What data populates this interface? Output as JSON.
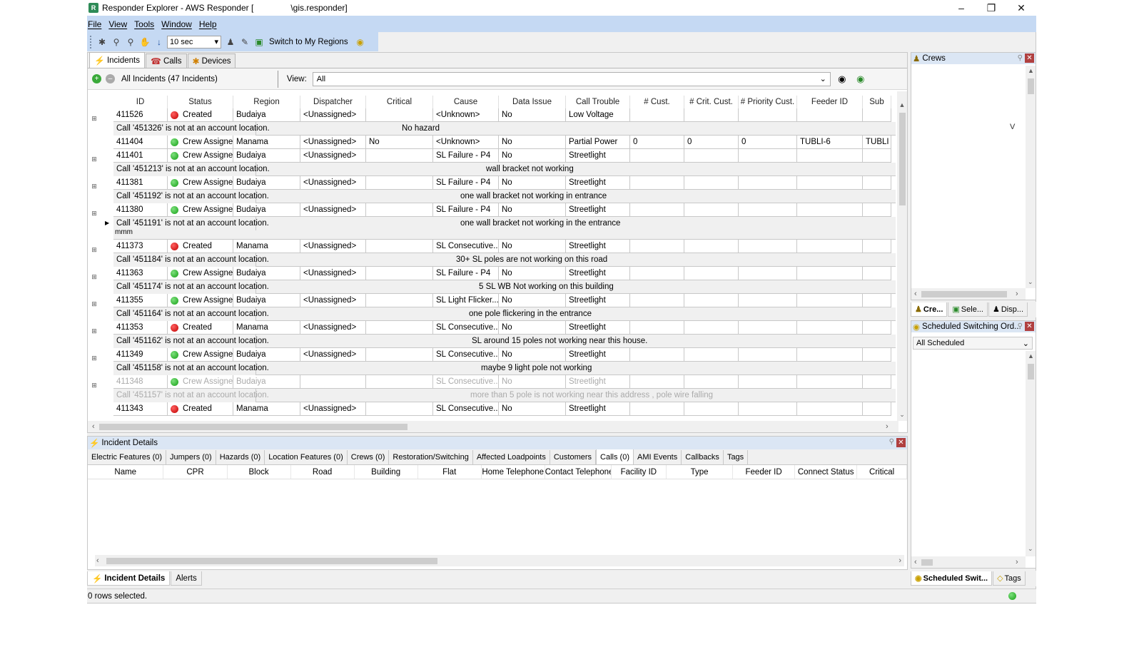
{
  "window": {
    "title": "Responder Explorer - AWS Responder [",
    "title_suffix": "\\gis.responder]"
  },
  "menu": [
    "File",
    "View",
    "Tools",
    "Window",
    "Help"
  ],
  "toolbar": {
    "interval": "10 sec",
    "switch_label": "Switch to My Regions"
  },
  "tabs": {
    "incidents": "Incidents",
    "calls": "Calls",
    "devices": "Devices"
  },
  "filter": {
    "all_label": "All Incidents (47 Incidents)",
    "view_label": "View:",
    "view_value": "All"
  },
  "columns": [
    "ID",
    "Status",
    "Region",
    "Dispatcher",
    "Critical",
    "Cause",
    "Data Issue",
    "Call Trouble",
    "# Cust.",
    "# Crit. Cust.",
    "# Priority Cust.",
    "Feeder ID",
    "Sub"
  ],
  "rows": [
    {
      "id": "411526",
      "status": "Created",
      "status_color": "#c00000",
      "region": "Budaiya",
      "dispatcher": "<Unassigned>",
      "critical": "",
      "cause": "<Unknown>",
      "data_issue": "No",
      "call_trouble": "Low Voltage",
      "cust": "",
      "crit": "",
      "prio": "",
      "feeder": "",
      "sub": "",
      "call": "Call '451326' is not at an account location.",
      "call_note": "No hazard"
    },
    {
      "id": "411404",
      "status": "Crew Assigned",
      "status_color": "#14a014",
      "region": "Manama",
      "dispatcher": "<Unassigned>",
      "critical": "No",
      "cause": "<Unknown>",
      "data_issue": "No",
      "call_trouble": "Partial Power",
      "cust": "0",
      "crit": "0",
      "prio": "0",
      "feeder": "TUBLI-6",
      "sub": "TUBLI",
      "call": "",
      "call_note": ""
    },
    {
      "id": "411401",
      "status": "Crew Assigned",
      "status_color": "#14a014",
      "region": "Budaiya",
      "dispatcher": "<Unassigned>",
      "critical": "",
      "cause": "SL Failure - P4",
      "data_issue": "No",
      "call_trouble": "Streetlight",
      "cust": "",
      "crit": "",
      "prio": "",
      "feeder": "",
      "sub": "",
      "call": "Call '451213' is not at an account location.",
      "call_note": "wall bracket not working"
    },
    {
      "id": "411381",
      "status": "Crew Assigned",
      "status_color": "#14a014",
      "region": "Budaiya",
      "dispatcher": "<Unassigned>",
      "critical": "",
      "cause": "SL Failure - P4",
      "data_issue": "No",
      "call_trouble": "Streetlight",
      "cust": "",
      "crit": "",
      "prio": "",
      "feeder": "",
      "sub": "",
      "call": "Call '451192' is not at an account location.",
      "call_note": "one wall bracket not working in entrance"
    },
    {
      "id": "411380",
      "status": "Crew Assigned",
      "status_color": "#14a014",
      "region": "Budaiya",
      "dispatcher": "<Unassigned>",
      "critical": "",
      "cause": "SL Failure - P4",
      "data_issue": "No",
      "call_trouble": "Streetlight",
      "cust": "",
      "crit": "",
      "prio": "",
      "feeder": "",
      "sub": "",
      "call": "Call '451191' is not at an account location.",
      "call_note": "one wall bracket not working in the entrance",
      "call_extra": "mmm"
    },
    {
      "id": "411373",
      "status": "Created",
      "status_color": "#c00000",
      "region": "Manama",
      "dispatcher": "<Unassigned>",
      "critical": "",
      "cause": "SL Consecutive...",
      "data_issue": "No",
      "call_trouble": "Streetlight",
      "cust": "",
      "crit": "",
      "prio": "",
      "feeder": "",
      "sub": "",
      "call": "Call '451184' is not at an account location.",
      "call_note": "30+ SL poles are not working on this road"
    },
    {
      "id": "411363",
      "status": "Crew Assigned",
      "status_color": "#14a014",
      "region": "Budaiya",
      "dispatcher": "<Unassigned>",
      "critical": "",
      "cause": "SL Failure - P4",
      "data_issue": "No",
      "call_trouble": "Streetlight",
      "cust": "",
      "crit": "",
      "prio": "",
      "feeder": "",
      "sub": "",
      "call": "Call '451174' is not at an account location.",
      "call_note": "5 SL WB Not working on this building"
    },
    {
      "id": "411355",
      "status": "Crew Assigned",
      "status_color": "#14a014",
      "region": "Budaiya",
      "dispatcher": "<Unassigned>",
      "critical": "",
      "cause": "SL Light Flicker...",
      "data_issue": "No",
      "call_trouble": "Streetlight",
      "cust": "",
      "crit": "",
      "prio": "",
      "feeder": "",
      "sub": "",
      "call": "Call '451164' is not at an account location.",
      "call_note": "one pole flickering in the entrance"
    },
    {
      "id": "411353",
      "status": "Created",
      "status_color": "#c00000",
      "region": "Manama",
      "dispatcher": "<Unassigned>",
      "critical": "",
      "cause": "SL Consecutive...",
      "data_issue": "No",
      "call_trouble": "Streetlight",
      "cust": "",
      "crit": "",
      "prio": "",
      "feeder": "",
      "sub": "",
      "call": "Call '451162' is not at an account location.",
      "call_note": "SL around 15 poles not working near this house."
    },
    {
      "id": "411349",
      "status": "Crew Assigned",
      "status_color": "#14a014",
      "region": "Budaiya",
      "dispatcher": "<Unassigned>",
      "critical": "",
      "cause": "SL Consecutive...",
      "data_issue": "No",
      "call_trouble": "Streetlight",
      "cust": "",
      "crit": "",
      "prio": "",
      "feeder": "",
      "sub": "",
      "call": "Call '451158' is not at an account location.",
      "call_note": "maybe 9 light pole not working"
    },
    {
      "id": "411348",
      "status": "Crew Assigned",
      "status_color": "#14a014",
      "region": "Budaiya",
      "dispatcher": "",
      "critical": "",
      "cause": "SL Consecutive...",
      "data_issue": "No",
      "call_trouble": "Streetlight",
      "cust": "",
      "crit": "",
      "prio": "",
      "feeder": "",
      "sub": "",
      "call": "Call '451157' is not at an account location.",
      "call_note": "more than 5 pole is not working near this address  , pole wire falling",
      "faded": true
    },
    {
      "id": "411343",
      "status": "Created",
      "status_color": "#c00000",
      "region": "Manama",
      "dispatcher": "<Unassigned>",
      "critical": "",
      "cause": "SL Consecutive...",
      "data_issue": "No",
      "call_trouble": "Streetlight",
      "cust": "",
      "crit": "",
      "prio": "",
      "feeder": "",
      "sub": "",
      "call": "",
      "call_note": ""
    }
  ],
  "details": {
    "title": "Incident Details",
    "tabs": [
      "Electric Features (0)",
      "Jumpers (0)",
      "Hazards (0)",
      "Location Features (0)",
      "Crews (0)",
      "Restoration/Switching",
      "Affected Loadpoints",
      "Customers",
      "Calls (0)",
      "AMI Events",
      "Callbacks",
      "Tags"
    ],
    "active_tab": 8,
    "columns": [
      "Name",
      "CPR",
      "Block",
      "Road",
      "Building",
      "Flat",
      "Home Telephone",
      "Contact Telephone",
      "Facility ID",
      "Type",
      "Feeder ID",
      "Connect Status",
      "Critical"
    ]
  },
  "bottom_tabs": [
    "Incident Details",
    "Alerts"
  ],
  "status_text": "0 rows selected.",
  "crews_panel": {
    "title": "Crews",
    "tabs": [
      "Cre...",
      "Sele...",
      "Disp..."
    ],
    "marker": "V"
  },
  "switching_panel": {
    "title": "Scheduled Switching Ord...",
    "filter": "All Scheduled",
    "tabs": [
      "Scheduled Swit...",
      "Tags"
    ]
  }
}
